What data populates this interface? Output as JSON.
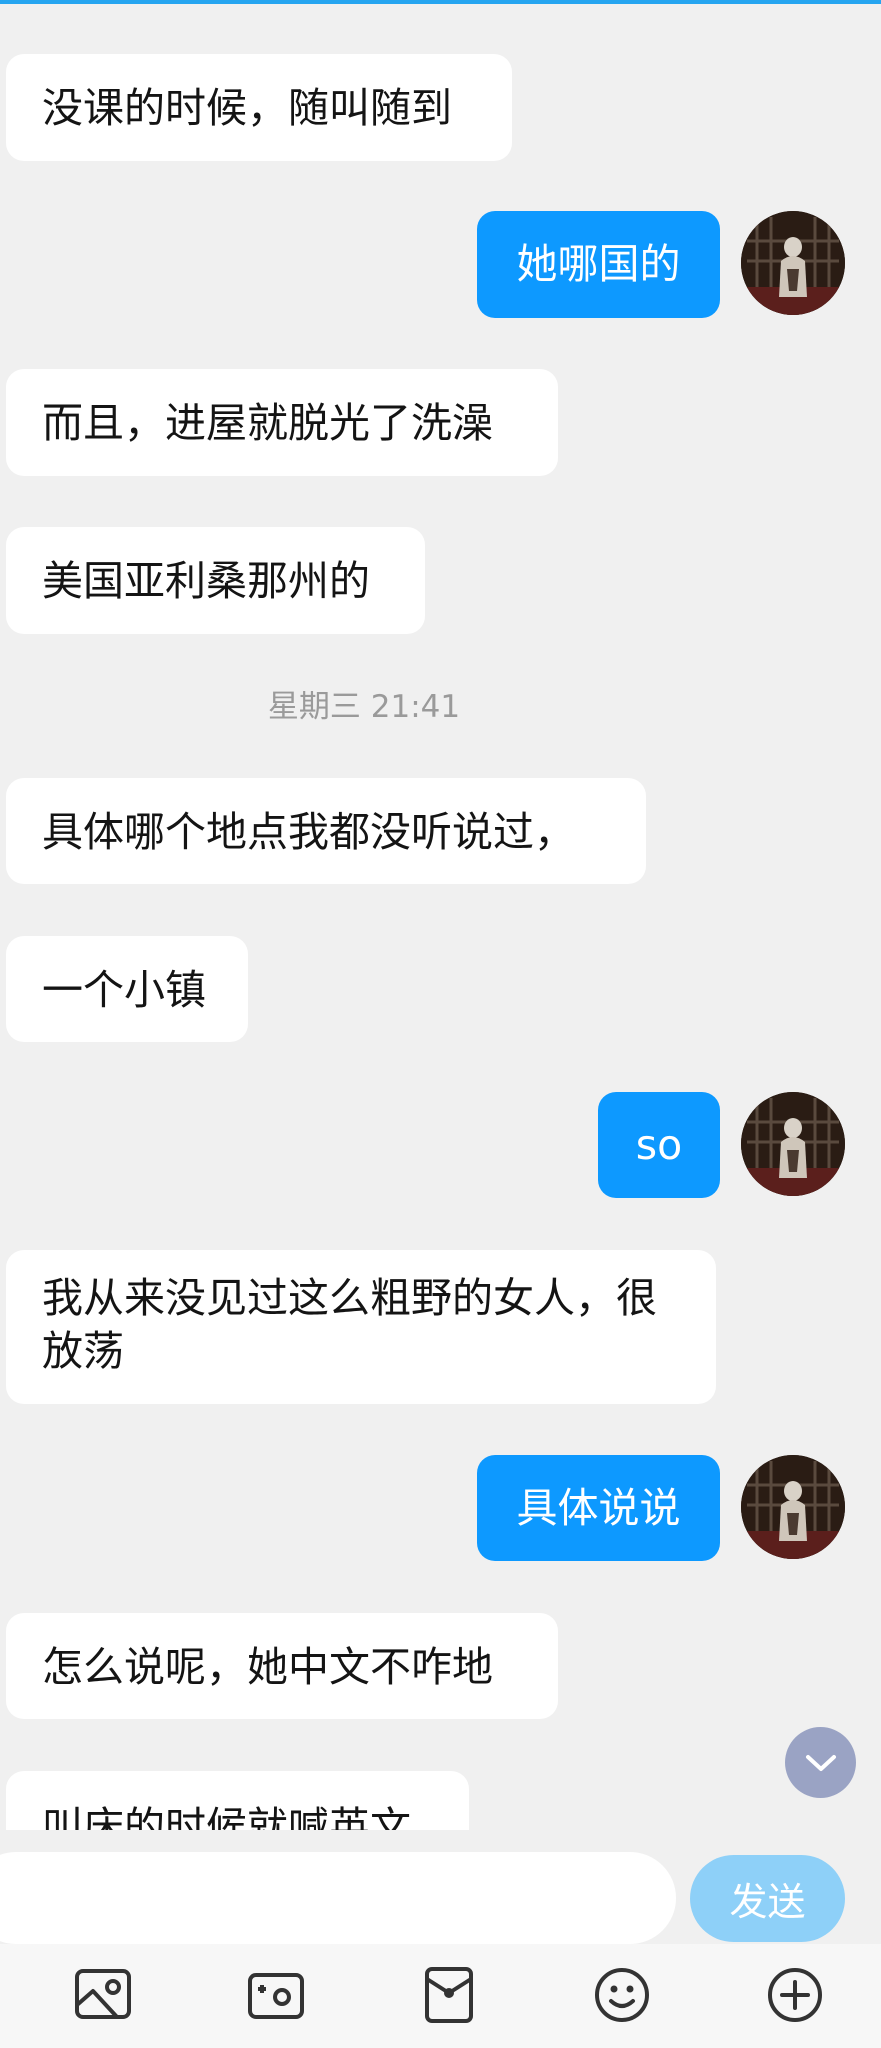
{
  "chat": {
    "messages": [
      {
        "side": "in",
        "text": "没课的时候，随叫随到"
      },
      {
        "side": "out",
        "text": "她哪国的"
      },
      {
        "side": "in",
        "text": "而且，进屋就脱光了洗澡"
      },
      {
        "side": "in",
        "text": "美国亚利桑那州的"
      },
      {
        "side": "in",
        "text": "具体哪个地点我都没听说过，"
      },
      {
        "side": "in",
        "text": "一个小镇"
      },
      {
        "side": "out",
        "text": "so"
      },
      {
        "side": "in",
        "text": "我从来没见过这么粗野的女人，很放荡"
      },
      {
        "side": "out",
        "text": "具体说说"
      },
      {
        "side": "in",
        "text": "怎么说呢，她中文不咋地"
      },
      {
        "side": "in",
        "text": "叫床的时候就喊英文"
      }
    ],
    "timestamp": "星期三 21:41"
  },
  "input": {
    "value": "",
    "send_label": "发送"
  },
  "toolbar": {
    "icons": [
      "image-icon",
      "camera-icon",
      "red-packet-icon",
      "emoji-icon",
      "plus-icon"
    ]
  },
  "colors": {
    "accent": "#0d99ff",
    "send_disabled": "#8ed0f8",
    "background": "#f0f0f0",
    "scroll_button": "#9aa3c4"
  }
}
